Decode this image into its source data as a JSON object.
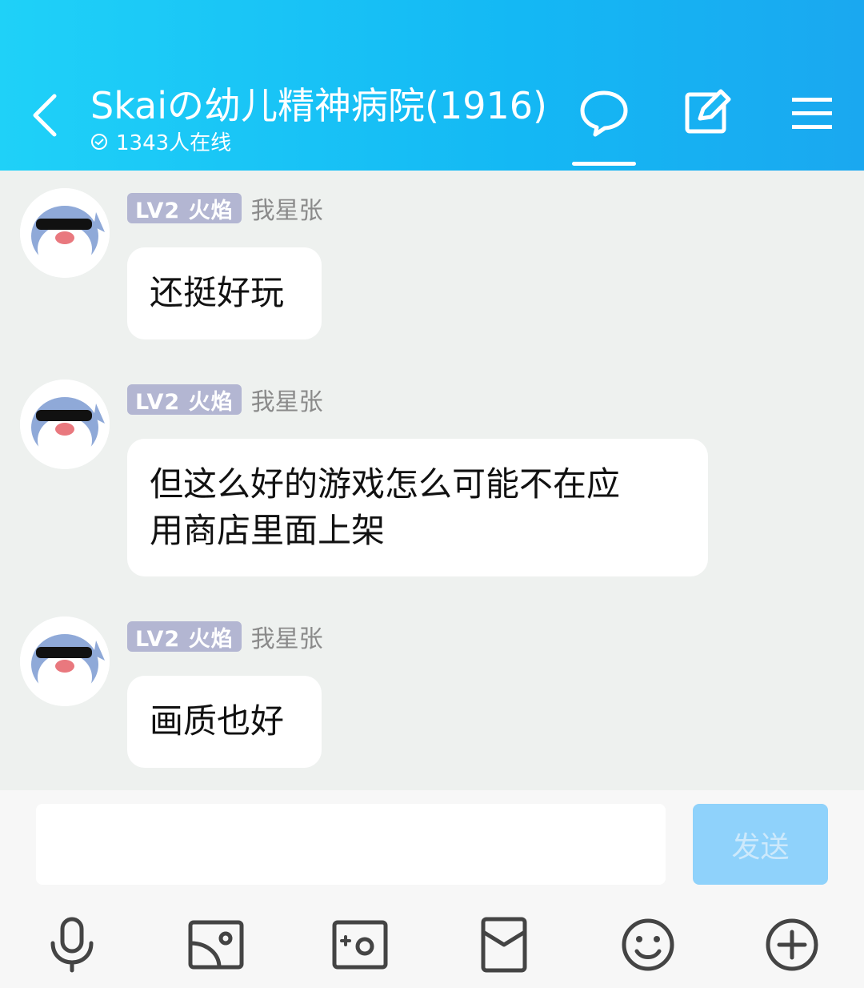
{
  "header": {
    "title": "Skaiの幼儿精神病院(1916)",
    "online": "1343人在线",
    "colors": {
      "from": "#1fd1f8",
      "to": "#1aa8f0"
    }
  },
  "messages": [
    {
      "badge": "LV2 火焰",
      "user": "我星张",
      "text_lines": [
        "还挺好玩"
      ]
    },
    {
      "badge": "LV2 火焰",
      "user": "我星张",
      "text_lines": [
        "但这么好的游戏怎么可能不在应",
        "用商店里面上架"
      ]
    },
    {
      "badge": "LV2 火焰",
      "user": "我星张",
      "text_lines": [
        "画质也好"
      ]
    }
  ],
  "composer": {
    "send_label": "发送",
    "input_value": ""
  },
  "toolbar": {
    "icons": [
      "microphone-icon",
      "image-icon",
      "camera-icon",
      "red-packet-icon",
      "emoji-icon",
      "plus-icon"
    ]
  }
}
